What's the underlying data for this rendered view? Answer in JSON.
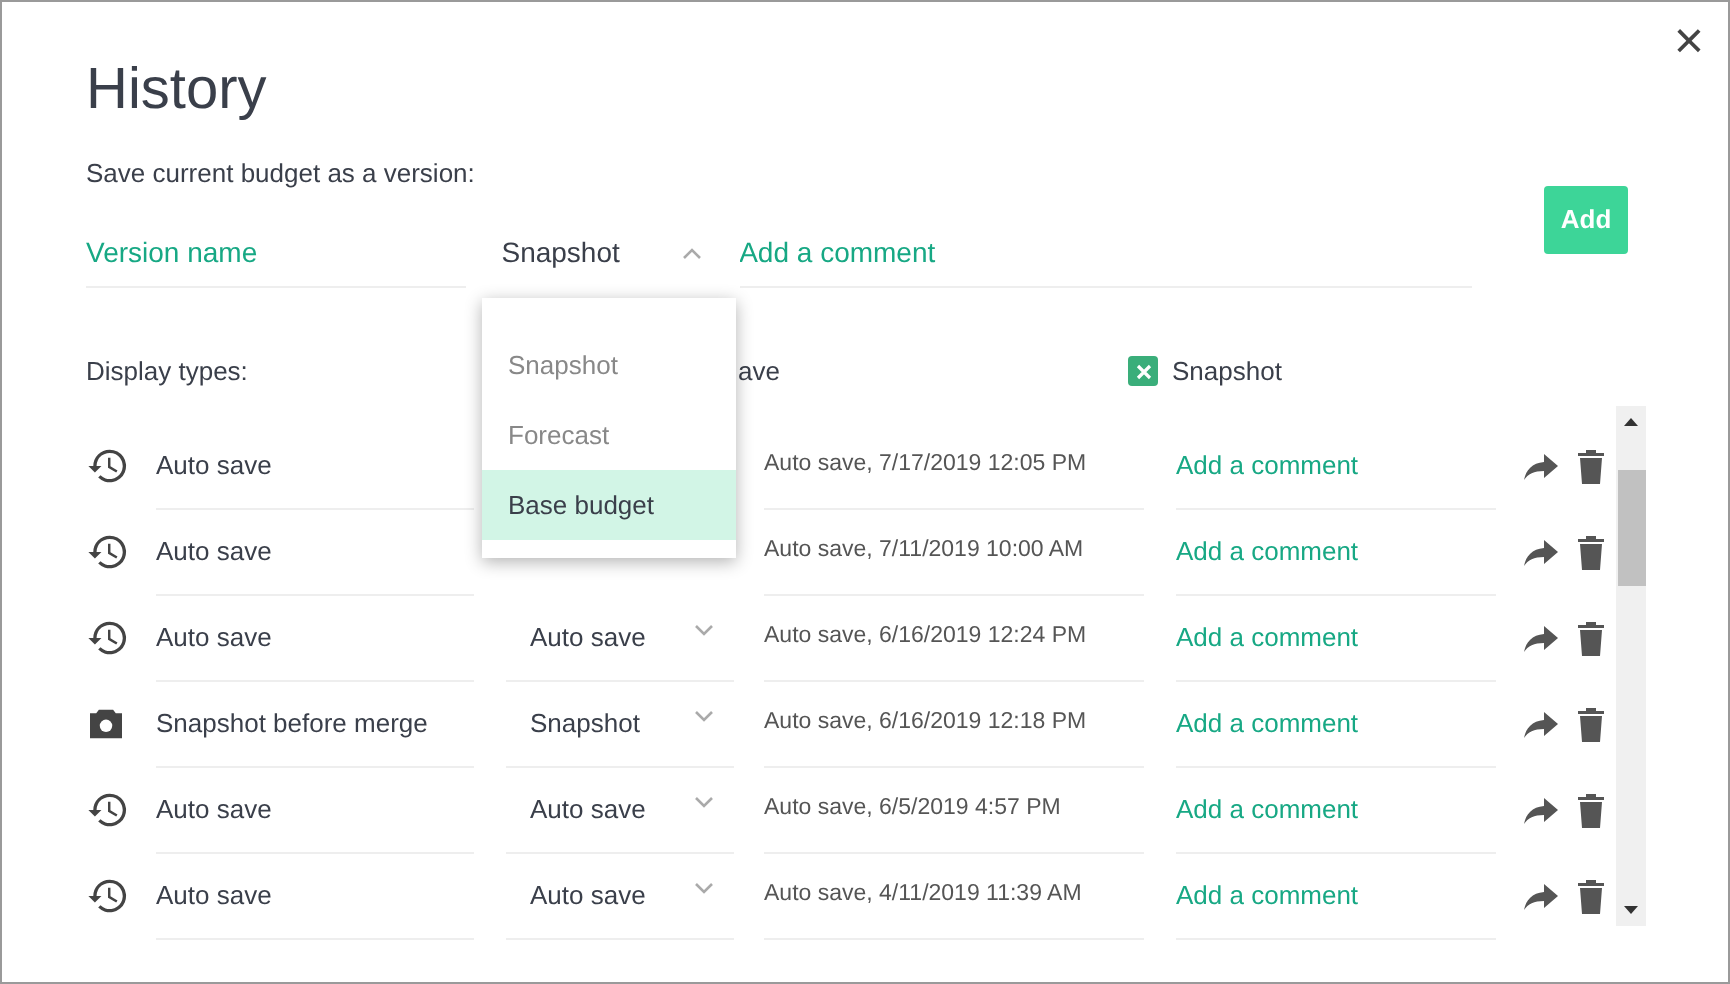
{
  "dialog": {
    "title": "History",
    "close": "×"
  },
  "save_section": {
    "label": "Save current budget as a version:",
    "version_name": {
      "placeholder": "Version name"
    },
    "type_select": {
      "value": "Snapshot",
      "expanded": true
    },
    "comment": {
      "placeholder": "Add a comment"
    },
    "add_button": "Add"
  },
  "type_menu": [
    {
      "label": "Snapshot",
      "selected": false
    },
    {
      "label": "Forecast",
      "selected": false
    },
    {
      "label": "Base budget",
      "selected": true
    }
  ],
  "display_types": {
    "label": "Display types:",
    "filters": [
      {
        "label": "ave",
        "kind": "cut"
      },
      {
        "label": "Snapshot",
        "checked": true,
        "kind": "full"
      }
    ]
  },
  "versions": [
    {
      "kind": "auto",
      "name": "Auto save",
      "date": "Auto save, 7/17/2019 12:05 PM",
      "comment": "Add a comment"
    },
    {
      "kind": "auto",
      "name": "Auto save",
      "date": "Auto save, 7/11/2019 10:00 AM",
      "comment": "Add a comment"
    },
    {
      "kind": "auto",
      "name": "Auto save",
      "type": "Auto save",
      "date": "Auto save, 6/16/2019 12:24 PM",
      "comment": "Add a comment"
    },
    {
      "kind": "snapshot",
      "name": "Snapshot before merge",
      "type": "Snapshot",
      "date": "Auto save, 6/16/2019 12:18 PM",
      "comment": "Add a comment"
    },
    {
      "kind": "auto",
      "name": "Auto save",
      "type": "Auto save",
      "date": "Auto save, 6/5/2019 4:57 PM",
      "comment": "Add a comment"
    },
    {
      "kind": "auto",
      "name": "Auto save",
      "type": "Auto save",
      "date": "Auto save, 4/11/2019 11:39 AM",
      "comment": "Add a comment"
    }
  ]
}
